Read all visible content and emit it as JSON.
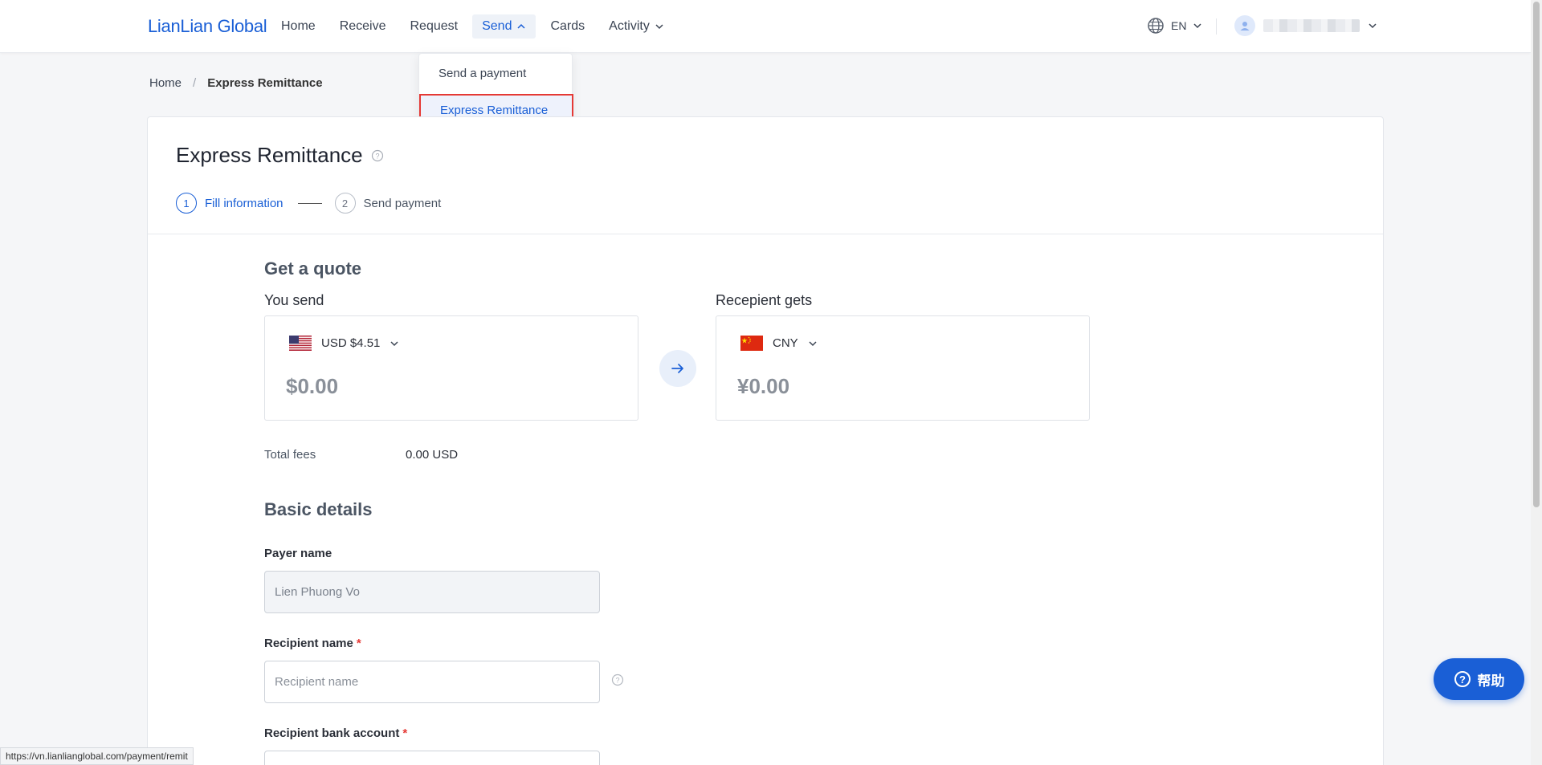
{
  "brand": {
    "logo": "LianLian Global",
    "accent": "#1a5fd6"
  },
  "nav": {
    "items": [
      {
        "label": "Home"
      },
      {
        "label": "Receive"
      },
      {
        "label": "Request"
      },
      {
        "label": "Send"
      },
      {
        "label": "Cards"
      },
      {
        "label": "Activity"
      }
    ],
    "lang": "EN"
  },
  "send_menu": {
    "items": [
      {
        "label": "Send a payment"
      },
      {
        "label": "Express Remittance"
      }
    ]
  },
  "breadcrumb": {
    "home": "Home",
    "sep": "/",
    "current": "Express Remittance"
  },
  "page": {
    "title": "Express Remittance",
    "steps": [
      {
        "num": "1",
        "label": "Fill information"
      },
      {
        "num": "2",
        "label": "Send payment"
      }
    ]
  },
  "quote": {
    "title": "Get a quote",
    "you_send": {
      "label": "You send",
      "currency": "USD $4.51",
      "amount": "$0.00"
    },
    "recipient_gets": {
      "label": "Recepient gets",
      "currency": "CNY",
      "amount": "¥0.00"
    },
    "fees_label": "Total fees",
    "fees_value": "0.00 USD"
  },
  "basic": {
    "title": "Basic details",
    "payer_name": {
      "label": "Payer name",
      "value": "Lien Phuong Vo"
    },
    "recipient_name": {
      "label": "Recipient name",
      "placeholder": "Recipient name"
    },
    "recipient_bank": {
      "label": "Recipient bank account"
    }
  },
  "help": {
    "label": "帮助"
  },
  "status_url": "https://vn.lianlianglobal.com/payment/remit"
}
